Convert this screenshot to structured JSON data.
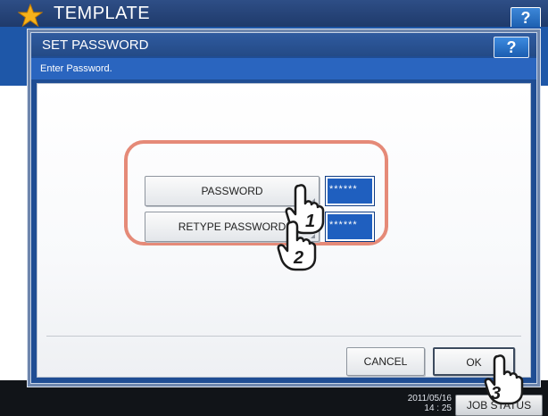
{
  "background": {
    "title": "TEMPLATE",
    "help_label": "?",
    "clock_line1": "2011/05/16",
    "clock_line2": "14 : 25",
    "job_status_label": "JOB STATUS"
  },
  "dialog": {
    "title": "SET PASSWORD",
    "help_label": "?",
    "prompt": "Enter Password.",
    "password_button": "PASSWORD",
    "password_value": "******",
    "retype_button": "RETYPE PASSWORD",
    "retype_value": "******",
    "cancel_label": "CANCEL",
    "ok_label": "OK"
  },
  "callouts": {
    "step1": "1",
    "step2": "2",
    "step3": "3"
  },
  "colors": {
    "accent_blue": "#1e57a8",
    "highlight": "#e58a78"
  }
}
